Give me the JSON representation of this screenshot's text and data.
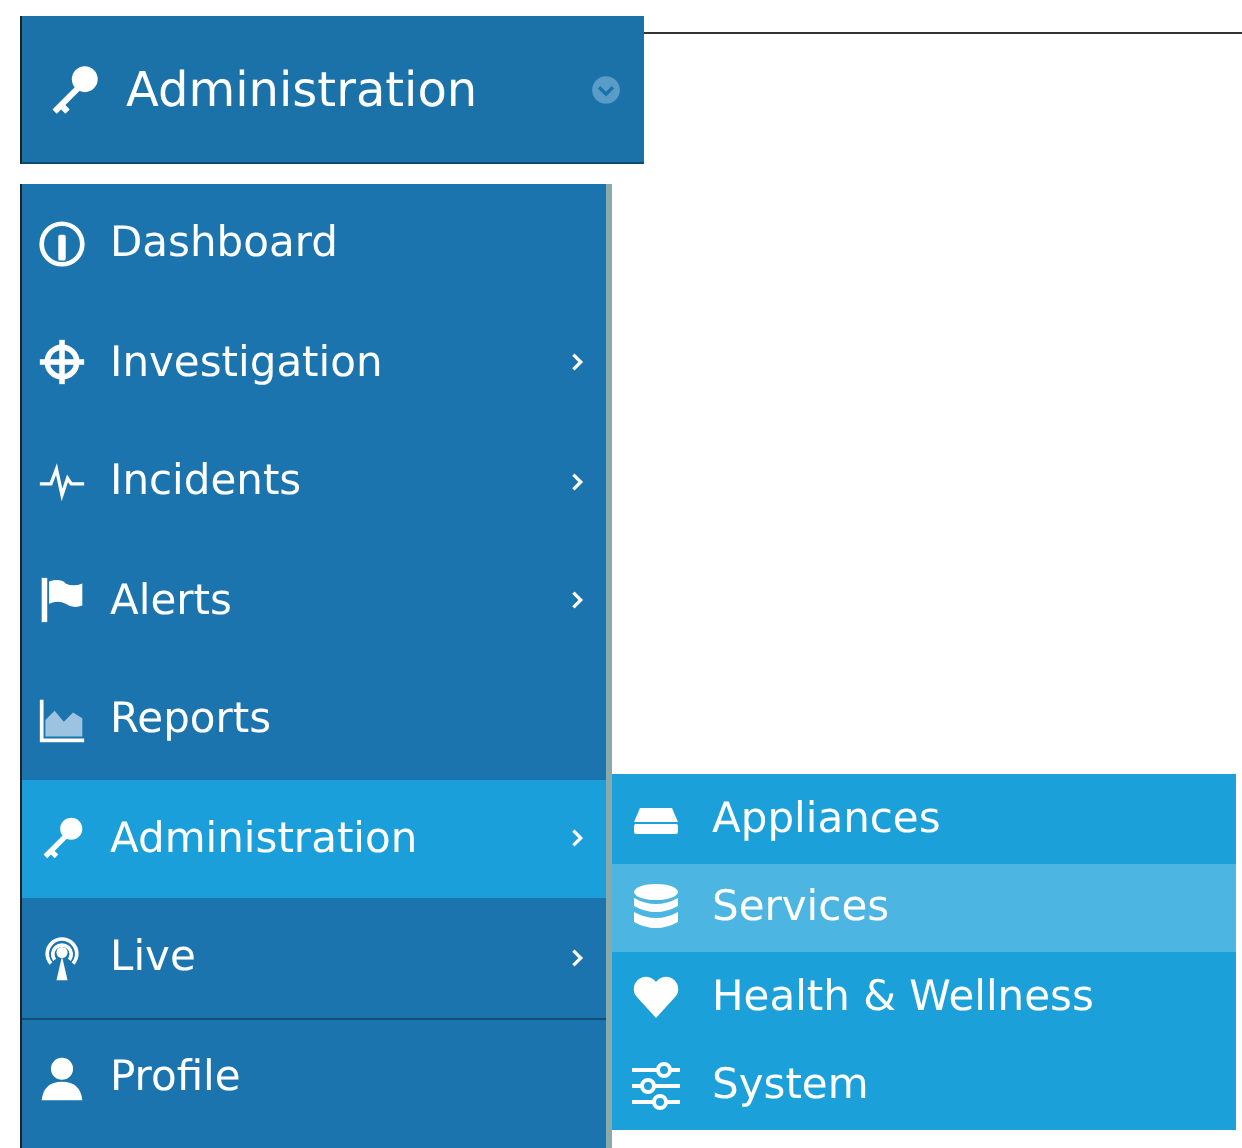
{
  "header": {
    "title": "Administration"
  },
  "menu": [
    {
      "label": "Dashboard",
      "submenu": false,
      "selected": false
    },
    {
      "label": "Investigation",
      "submenu": true,
      "selected": false
    },
    {
      "label": "Incidents",
      "submenu": true,
      "selected": false
    },
    {
      "label": "Alerts",
      "submenu": true,
      "selected": false
    },
    {
      "label": "Reports",
      "submenu": false,
      "selected": false
    },
    {
      "label": "Administration",
      "submenu": true,
      "selected": true
    },
    {
      "label": "Live",
      "submenu": true,
      "selected": false
    },
    {
      "label": "Profile",
      "submenu": false,
      "selected": false
    }
  ],
  "submenu": [
    {
      "label": "Appliances",
      "selected": false
    },
    {
      "label": "Services",
      "selected": true
    },
    {
      "label": "Health & Wellness",
      "selected": false
    },
    {
      "label": "System",
      "selected": false
    }
  ]
}
